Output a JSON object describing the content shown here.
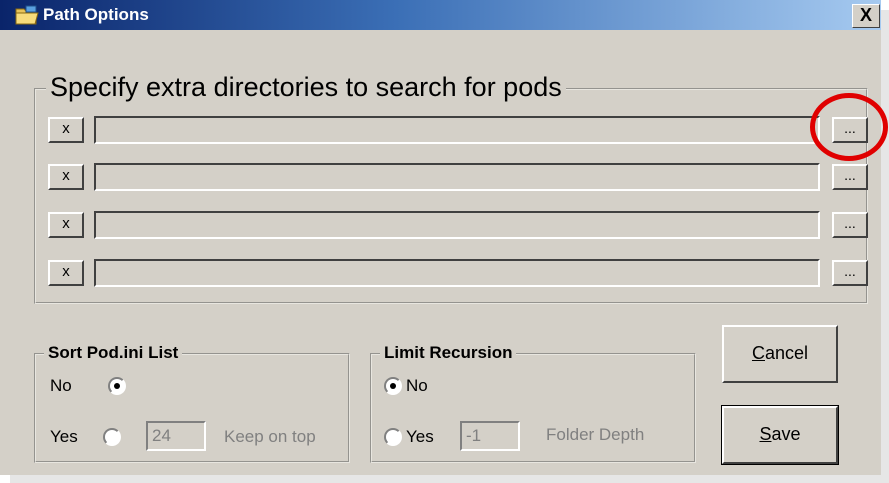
{
  "window": {
    "title": "Path Options",
    "close_label": "X"
  },
  "directories": {
    "legend": "Specify extra directories to search for pods",
    "rows": [
      {
        "remove_label": "x",
        "path": "",
        "browse_label": "..."
      },
      {
        "remove_label": "x",
        "path": "",
        "browse_label": "..."
      },
      {
        "remove_label": "x",
        "path": "",
        "browse_label": "..."
      },
      {
        "remove_label": "x",
        "path": "",
        "browse_label": "..."
      }
    ]
  },
  "sort": {
    "legend": "Sort Pod.ini List",
    "no_label": "No",
    "yes_label": "Yes",
    "selected": "No",
    "count_value": "24",
    "keep_label": "Keep on top"
  },
  "recursion": {
    "legend": "Limit Recursion",
    "no_label": "No",
    "yes_label": "Yes",
    "selected": "No",
    "depth_value": "-1",
    "depth_label": "Folder Depth"
  },
  "buttons": {
    "cancel_label": "Cancel",
    "save_label": "Save"
  },
  "colors": {
    "title_start": "#0a246a",
    "title_end": "#a6caf0",
    "face": "#d4d0c8",
    "highlight": "#e00000"
  }
}
